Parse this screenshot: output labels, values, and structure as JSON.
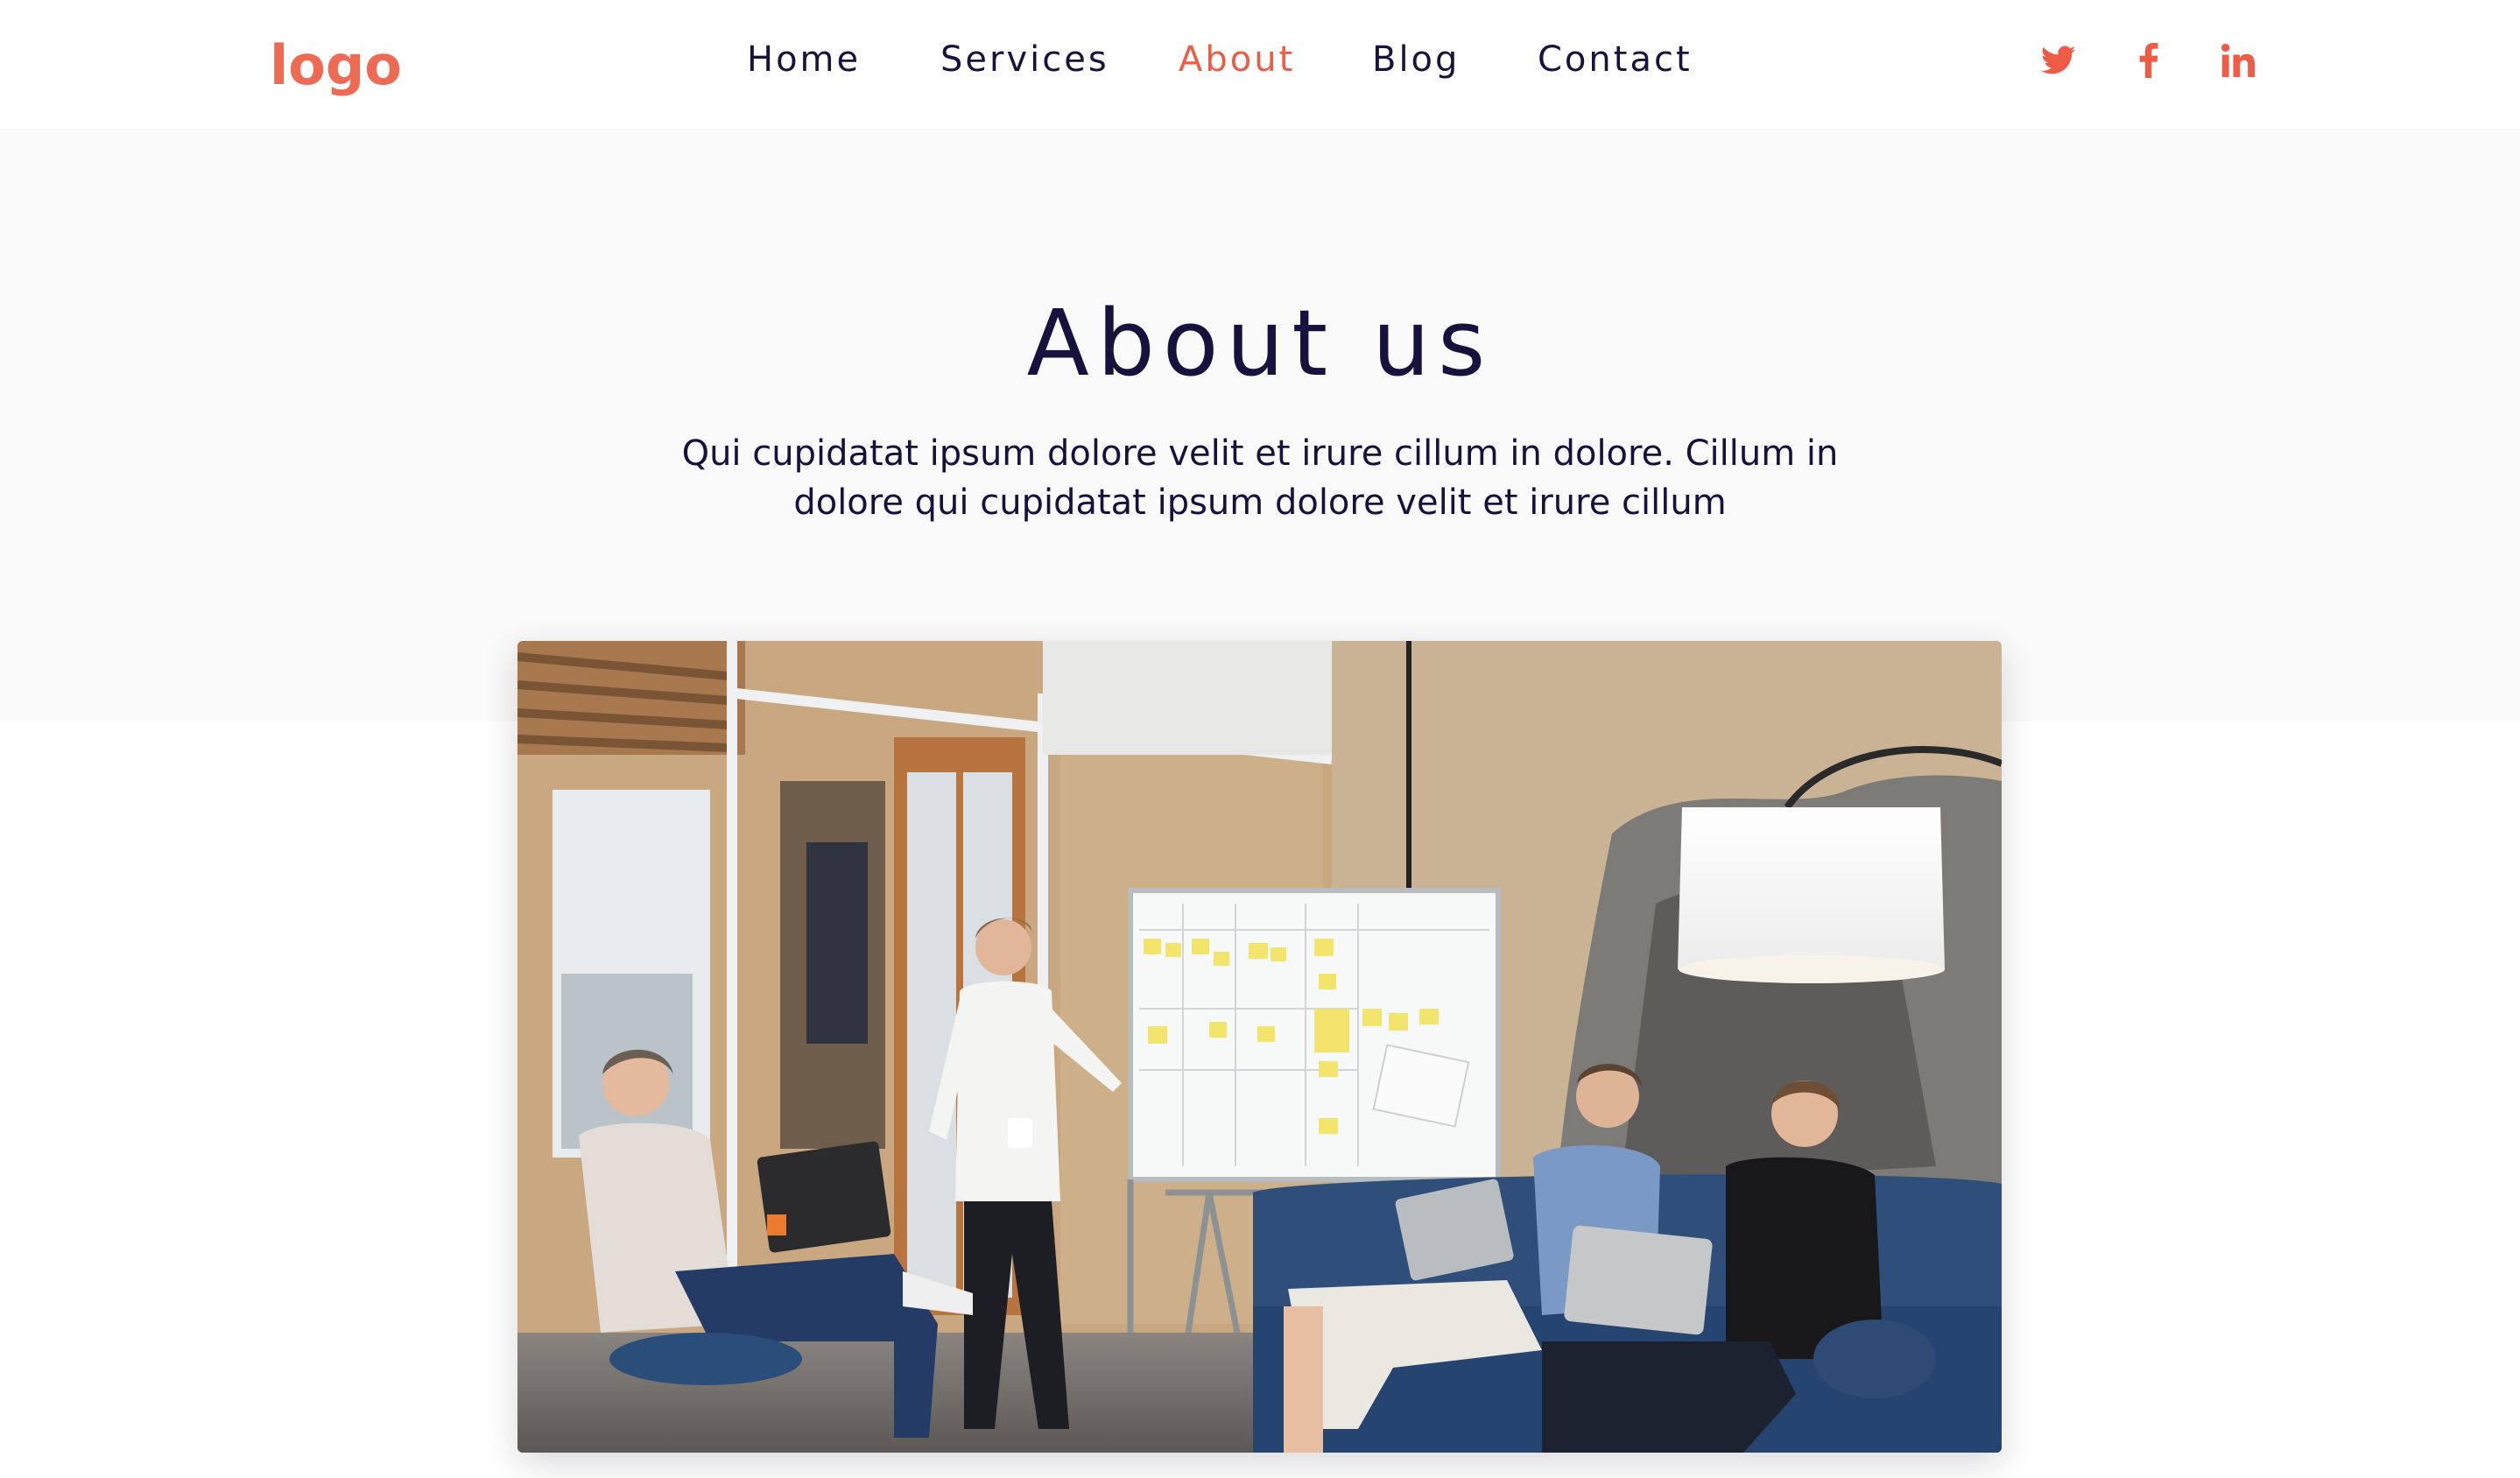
{
  "header": {
    "logo": "logo",
    "nav": [
      {
        "label": "Home",
        "active": false
      },
      {
        "label": "Services",
        "active": false
      },
      {
        "label": "About",
        "active": true
      },
      {
        "label": "Blog",
        "active": false
      },
      {
        "label": "Contact",
        "active": false
      }
    ],
    "social": [
      {
        "name": "twitter-icon"
      },
      {
        "name": "facebook-icon"
      },
      {
        "name": "linkedin-icon"
      }
    ]
  },
  "hero": {
    "title": "About us",
    "text_line1": "Qui cupidatat ipsum dolore velit et irure cillum in dolore. Cillum in",
    "text_line2": "dolore qui cupidatat ipsum dolore velit et irure cillum"
  },
  "photo": {
    "subject": "team-meeting-photo"
  },
  "colors": {
    "accent": "#ee5c45",
    "logo": "#ee6a52",
    "text": "#17113e",
    "hero_bg": "#fafafa"
  }
}
